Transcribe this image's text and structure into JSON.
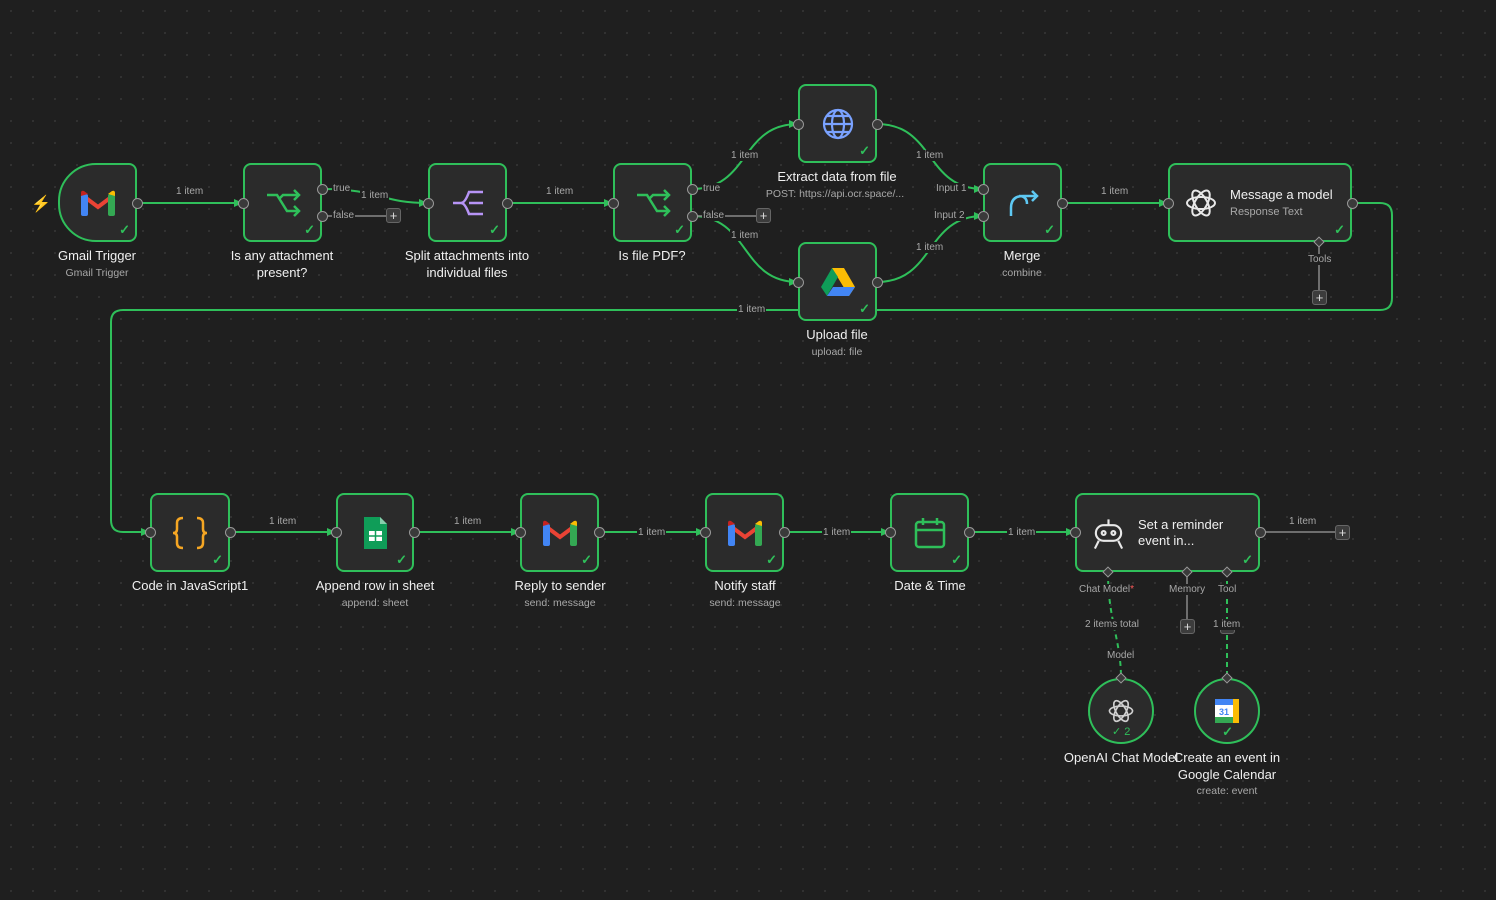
{
  "nodes": {
    "gmail_trigger": {
      "title": "Gmail Trigger",
      "subtitle": "Gmail Trigger"
    },
    "if_attachment": {
      "title": "Is any attachment present?"
    },
    "split": {
      "title": "Split attachments into individual files"
    },
    "if_pdf": {
      "title": "Is file PDF?"
    },
    "extract": {
      "title": "Extract data from file",
      "subtitle": "POST: https://api.ocr.space/..."
    },
    "upload": {
      "title": "Upload file",
      "subtitle": "upload: file"
    },
    "merge": {
      "title": "Merge",
      "subtitle": "combine"
    },
    "message_model": {
      "title": "Message a model",
      "subtitle": "Response Text"
    },
    "code_js": {
      "title": "Code in JavaScript1"
    },
    "append_row": {
      "title": "Append row in sheet",
      "subtitle": "append: sheet"
    },
    "reply_sender": {
      "title": "Reply to sender",
      "subtitle": "send: message"
    },
    "notify_staff": {
      "title": "Notify staff",
      "subtitle": "send: message"
    },
    "date_time": {
      "title": "Date & Time"
    },
    "reminder": {
      "title": "Set a reminder event in..."
    },
    "openai_chat": {
      "title": "OpenAI Chat Model",
      "badge": "2"
    },
    "gcal_event": {
      "title": "Create an event in Google Calendar",
      "subtitle": "create: event"
    }
  },
  "edge_labels": {
    "one_item": "1 item",
    "true": "true",
    "false": "false",
    "input1": "Input 1",
    "input2": "Input 2",
    "tools": "Tools",
    "chat_model": "Chat Model",
    "required": "*",
    "memory": "Memory",
    "tool": "Tool",
    "model": "Model",
    "two_items_total": "2 items total",
    "one_item_partial": "1 item"
  },
  "icons": {
    "trigger": "bolt-icon",
    "gmail": "gmail-icon",
    "if": "if-branch-icon",
    "split": "split-out-icon",
    "http": "globe-icon",
    "drive": "google-drive-icon",
    "merge": "merge-icon",
    "openai": "openai-icon",
    "code": "code-braces-icon",
    "sheets": "google-sheets-icon",
    "calendar": "calendar-icon",
    "agent": "robot-icon",
    "gcal": "google-calendar-icon"
  },
  "colors": {
    "canvas": "#1f1f1f",
    "node_bg": "#2b2b2b",
    "success": "#2fbf5a",
    "trigger": "#ff6d2e",
    "muted_text": "#a8a8a8"
  }
}
